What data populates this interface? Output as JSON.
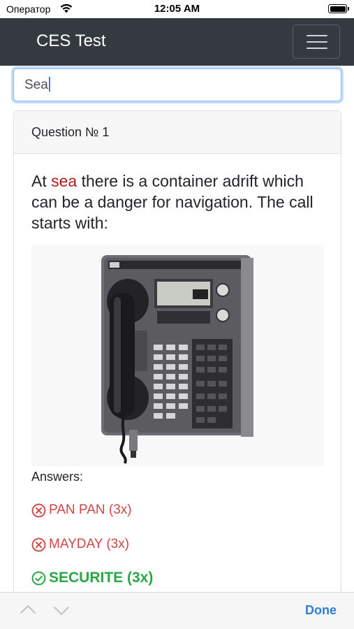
{
  "status_bar": {
    "carrier": "Оператор",
    "time": "12:05 AM"
  },
  "navbar": {
    "brand": "CES Test",
    "menu_icon": "hamburger-menu-icon"
  },
  "search": {
    "value": "Sea"
  },
  "question": {
    "header": "Question № 1",
    "text_before": "At ",
    "highlight": "sea",
    "text_after": " there is a container adrift which can be a danger for navigation. The call starts with:",
    "highlight_color": "#b01b1b",
    "image_icon": "vhf-radiotelephone-controller-image"
  },
  "answers": {
    "label": "Answers:",
    "items": [
      {
        "text": "PAN PAN (3x)",
        "correct": false,
        "icon": "x-circle-icon",
        "color": "#d04545"
      },
      {
        "text": "MAYDAY (3x)",
        "correct": false,
        "icon": "x-circle-icon",
        "color": "#d04545"
      },
      {
        "text": "SECURITE (3x)",
        "correct": true,
        "icon": "check-circle-icon",
        "color": "#28a745"
      }
    ]
  },
  "toolbar": {
    "prev_icon": "chevron-up-icon",
    "next_icon": "chevron-down-icon",
    "done_label": "Done"
  },
  "colors": {
    "navbar_bg": "#343a40",
    "link_blue": "#2f7fd7",
    "focus_border": "#80bdff"
  }
}
